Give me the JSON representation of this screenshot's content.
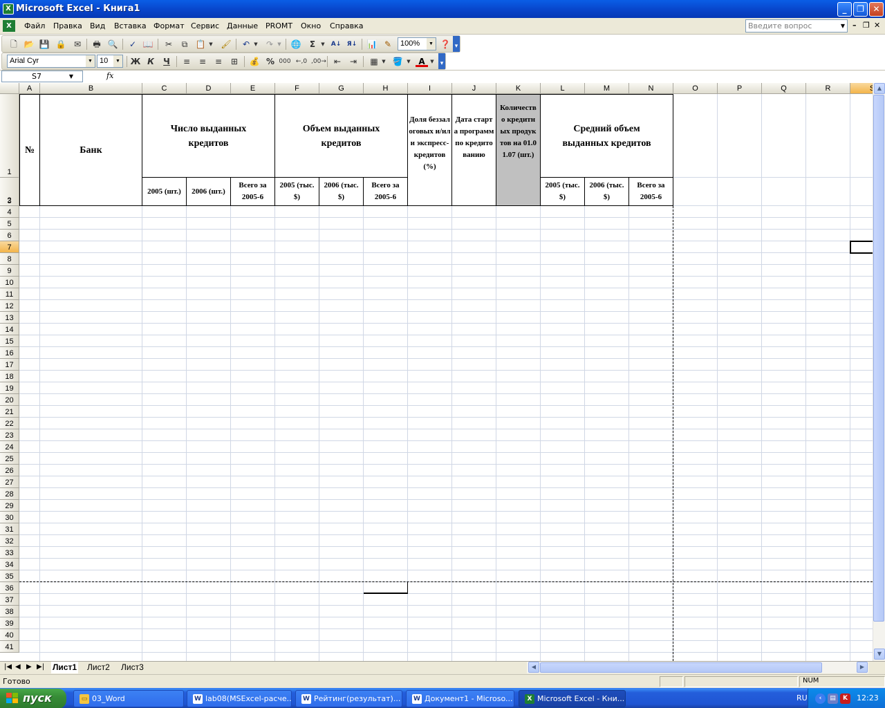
{
  "window": {
    "title": "Microsoft Excel - Книга1",
    "icon": "excel-icon"
  },
  "menu": {
    "items": [
      "Файл",
      "Правка",
      "Вид",
      "Вставка",
      "Формат",
      "Сервис",
      "Данные",
      "PROMT",
      "Окно",
      "Справка"
    ],
    "ask_placeholder": "Введите вопрос"
  },
  "toolbar": {
    "zoom": "100%",
    "font": "Arial Cyr",
    "font_size": "10",
    "bold": "Ж",
    "italic": "К",
    "underline": "Ч",
    "percent": "%",
    "thousands": "000",
    "sum": "Σ",
    "fx": "fx"
  },
  "namebox": {
    "value": "S7"
  },
  "columns": [
    "A",
    "B",
    "C",
    "D",
    "E",
    "F",
    "G",
    "H",
    "I",
    "J",
    "K",
    "L",
    "M",
    "N",
    "O",
    "P",
    "Q",
    "R",
    "S"
  ],
  "rows": [
    "1",
    "2",
    "3",
    "4",
    "5",
    "6",
    "7",
    "8",
    "9",
    "10",
    "11",
    "12",
    "13",
    "14",
    "15",
    "16",
    "17",
    "18",
    "19",
    "20",
    "21",
    "22",
    "23",
    "24",
    "25",
    "26",
    "27",
    "28",
    "29",
    "30",
    "31",
    "32",
    "33",
    "34",
    "35",
    "36",
    "37",
    "38",
    "39",
    "40",
    "41"
  ],
  "headers": {
    "num": "№",
    "bank": "Банк",
    "count_group": "Число выданных кредитов",
    "count_2005": "2005 (шт.)",
    "count_2006": "2006 (шт.)",
    "count_total": "Всего за 2005-6",
    "volume_group": "Объем выданных кредитов",
    "volume_2005": "2005 (тыс. $)",
    "volume_2006": "2006 (тыс. $)",
    "volume_total": "Всего за 2005-6",
    "share": "Доля беззалоговых и/или экспресс-кредитов (%)",
    "start_date": "Дата старта программ по кредитованию",
    "products": "Количество кредитных продуктов на 01.01.07 (шт.)",
    "avg_group": "Средний объем выданных кредитов",
    "avg_2005": "2005 (тыс. $)",
    "avg_2006": "2006 (тыс. $)",
    "avg_total": "Всего за 2005-6"
  },
  "sheets": [
    "Лист1",
    "Лист2",
    "Лист3"
  ],
  "status": {
    "text": "Готово",
    "num": "NUM"
  },
  "taskbar": {
    "start": "пуск",
    "tasks": [
      "03_Word",
      "lab08(MSExcel-расче...",
      "Рейтинг(результат)...",
      "Документ1 - Microso...",
      "Microsoft Excel - Кни..."
    ],
    "lang": "RU",
    "clock": "12:23"
  }
}
